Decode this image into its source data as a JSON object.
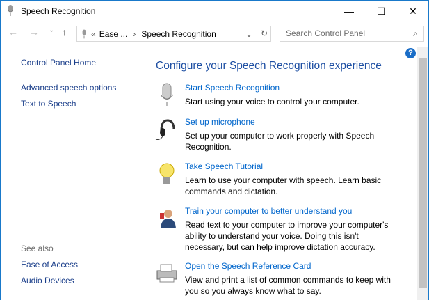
{
  "window": {
    "title": "Speech Recognition",
    "minimize": "—",
    "maximize": "☐",
    "close": "✕"
  },
  "nav": {
    "back": "←",
    "forward": "→",
    "recent": "⌄",
    "up": "↑",
    "crumb_sep": "«",
    "crumb1": "Ease ...",
    "sep": "›",
    "crumb2": "Speech Recognition",
    "dropdown": "⌄",
    "refresh": "↻",
    "search_placeholder": "Search Control Panel",
    "search_icon": "⌕"
  },
  "sidebar": {
    "home": "Control Panel Home",
    "items": [
      "Advanced speech options",
      "Text to Speech"
    ],
    "see_also": "See also",
    "see_also_items": [
      "Ease of Access",
      "Audio Devices"
    ]
  },
  "main": {
    "heading": "Configure your Speech Recognition experience",
    "help": "?",
    "items": [
      {
        "icon": "microphone-icon",
        "link": "Start Speech Recognition",
        "desc": "Start using your voice to control your computer."
      },
      {
        "icon": "headset-icon",
        "link": "Set up microphone",
        "desc": "Set up your computer to work properly with Speech Recognition."
      },
      {
        "icon": "lightbulb-icon",
        "link": "Take Speech Tutorial",
        "desc": "Learn to use your computer with speech.  Learn basic commands and dictation."
      },
      {
        "icon": "user-train-icon",
        "link": "Train your computer to better understand you",
        "desc": "Read text to your computer to improve your computer's ability to understand your voice.  Doing this isn't necessary, but can help improve dictation accuracy."
      },
      {
        "icon": "printer-icon",
        "link": "Open the Speech Reference Card",
        "desc": "View and print a list of common commands to keep with you so you always know what to say."
      }
    ]
  }
}
